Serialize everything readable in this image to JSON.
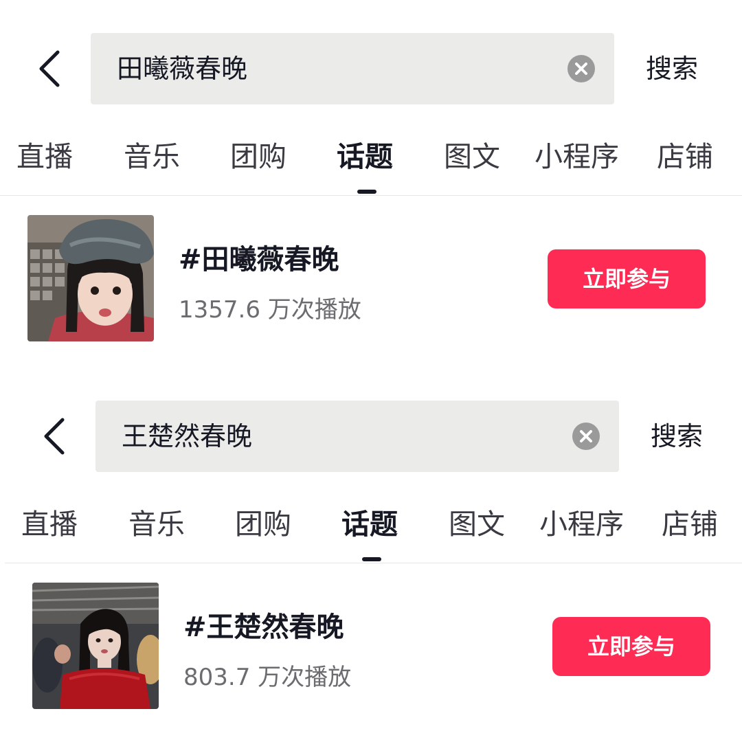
{
  "colors": {
    "accent": "#fe2c55",
    "search_bg": "#ebebea",
    "text_primary": "#161823",
    "text_secondary": "#6b6b70",
    "clear_icon_bg": "#9a9a9a",
    "divider": "#e6e6e6"
  },
  "panels": [
    {
      "search": {
        "back_icon": "chevron-left-icon",
        "query": "田曦薇春晚",
        "clear_icon": "clear-circle-icon",
        "submit_label": "搜索"
      },
      "tabs": [
        {
          "label": "直播"
        },
        {
          "label": "音乐"
        },
        {
          "label": "团购"
        },
        {
          "label": "话题"
        },
        {
          "label": "图文"
        },
        {
          "label": "小程序"
        },
        {
          "label": "店铺"
        }
      ],
      "active_tab": "话题",
      "result": {
        "title": "#田曦薇春晚",
        "plays": "1357.6 万次播放",
        "join_label": "立即参与"
      }
    },
    {
      "search": {
        "back_icon": "chevron-left-icon",
        "query": "王楚然春晚",
        "clear_icon": "clear-circle-icon",
        "submit_label": "搜索"
      },
      "tabs": [
        {
          "label": "直播"
        },
        {
          "label": "音乐"
        },
        {
          "label": "团购"
        },
        {
          "label": "话题"
        },
        {
          "label": "图文"
        },
        {
          "label": "小程序"
        },
        {
          "label": "店铺"
        }
      ],
      "active_tab": "话题",
      "result": {
        "title": "#王楚然春晚",
        "plays": "803.7 万次播放",
        "join_label": "立即参与"
      }
    }
  ]
}
